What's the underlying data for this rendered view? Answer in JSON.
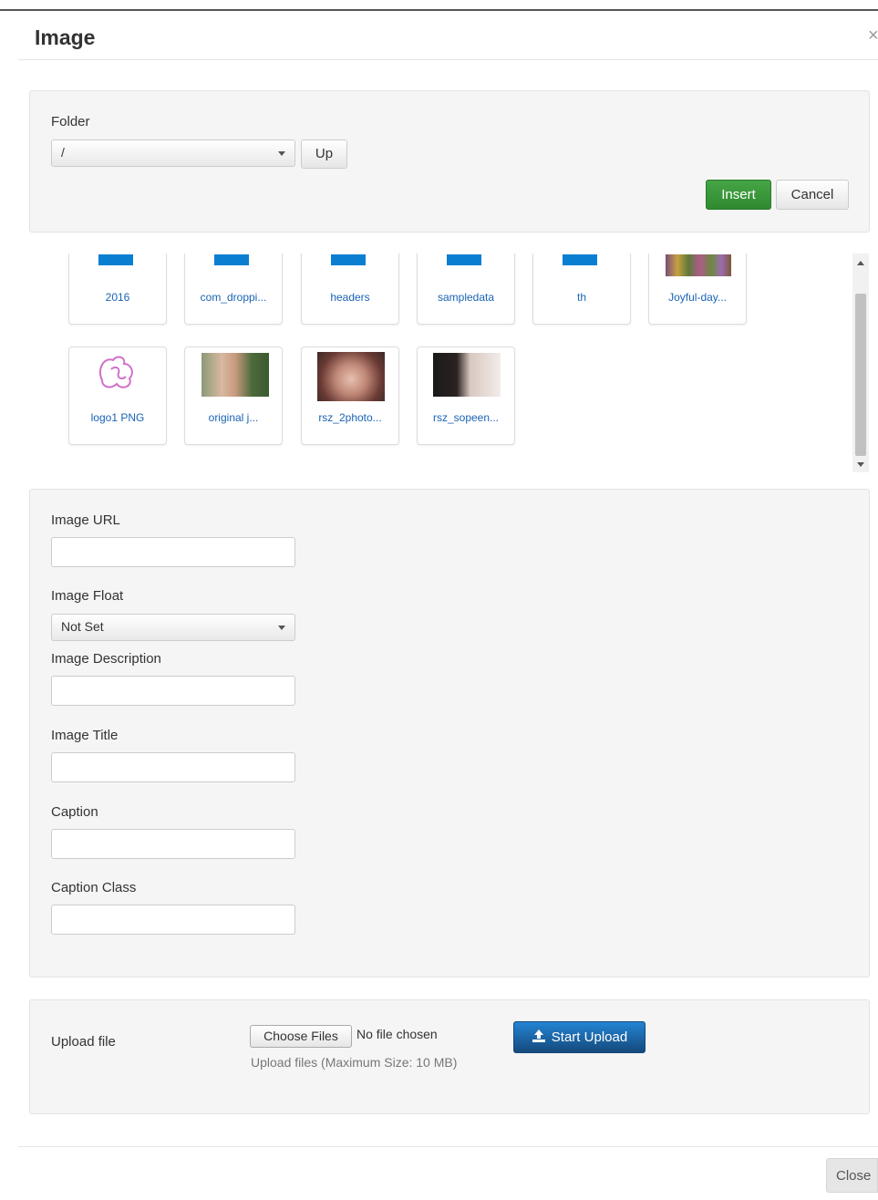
{
  "modal": {
    "title": "Image",
    "close_glyph": "×"
  },
  "folder_panel": {
    "folder_label": "Folder",
    "folder_value": "/",
    "up_label": "Up",
    "insert_label": "Insert",
    "cancel_label": "Cancel"
  },
  "media": {
    "folders": [
      {
        "name": "2016"
      },
      {
        "name": "com_droppi..."
      },
      {
        "name": "headers"
      },
      {
        "name": "sampledata"
      },
      {
        "name": "th"
      }
    ],
    "images": [
      {
        "name": "Joyful-day..."
      },
      {
        "name": "logo1 PNG"
      },
      {
        "name": "original j..."
      },
      {
        "name": "rsz_2photo..."
      },
      {
        "name": "rsz_sopeen..."
      }
    ]
  },
  "fields": {
    "image_url_label": "Image URL",
    "image_float_label": "Image Float",
    "image_float_value": "Not Set",
    "image_description_label": "Image Description",
    "image_title_label": "Image Title",
    "caption_label": "Caption",
    "caption_class_label": "Caption Class"
  },
  "upload": {
    "label": "Upload file",
    "choose_files_label": "Choose Files",
    "no_file_text": "No file chosen",
    "start_upload_label": "Start Upload",
    "hint": "Upload files (Maximum Size: 10 MB)"
  },
  "footer": {
    "close_label": "Close"
  },
  "colors": {
    "insert_green": "#46a546",
    "upload_blue": "#2384d3",
    "folder_blue": "#0a7fd1",
    "link_blue": "#1a63b5"
  }
}
